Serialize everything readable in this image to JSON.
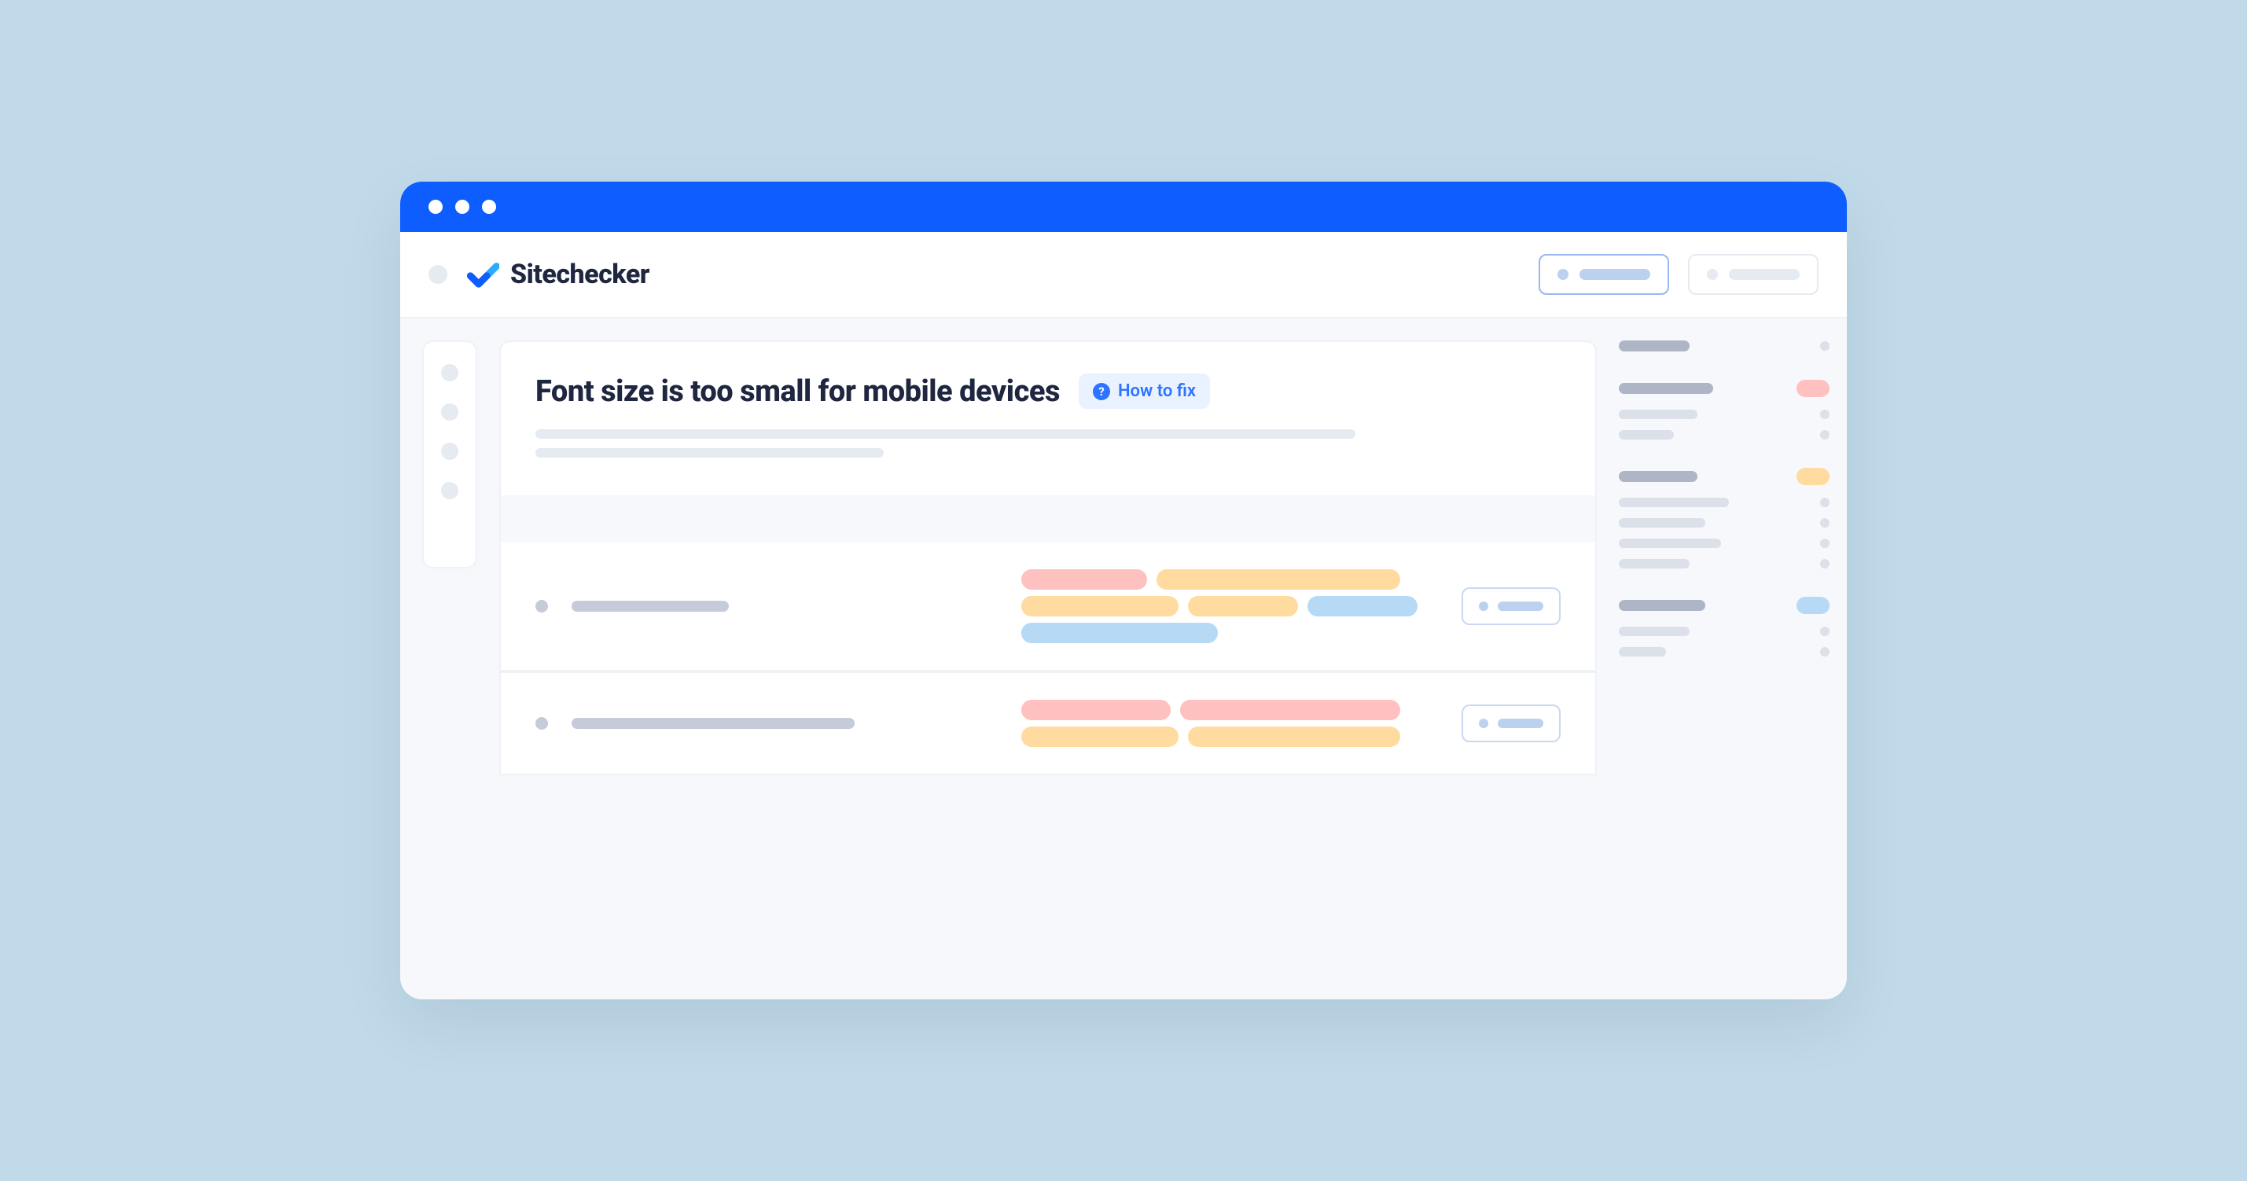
{
  "brand": "Sitechecker",
  "issue": {
    "title": "Font size is too small for mobile devices",
    "howto_label": "How to fix"
  },
  "colors": {
    "accent_blue": "#0d5dff",
    "pill_red": "#ffc0c0",
    "pill_orange": "#ffdba0",
    "pill_blue": "#b6daf5"
  }
}
